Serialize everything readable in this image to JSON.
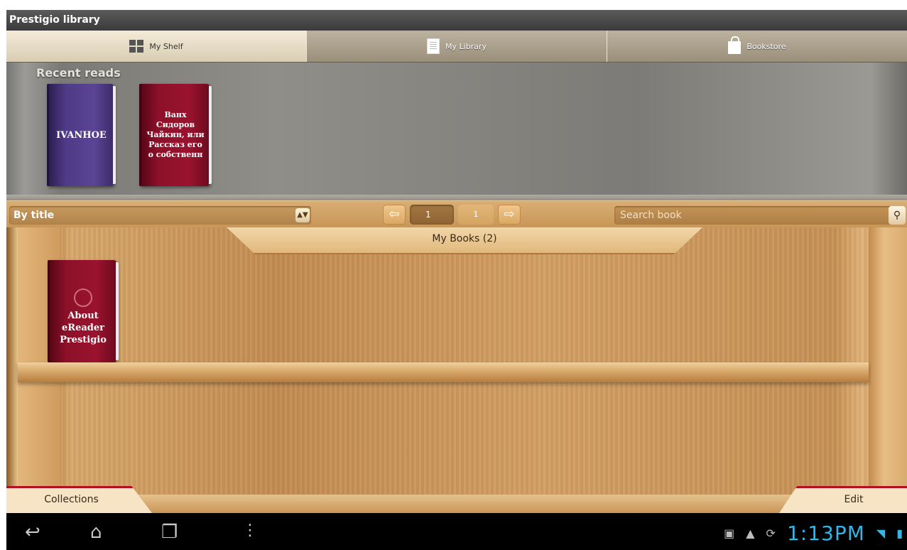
{
  "app": {
    "title": "Prestigio library"
  },
  "tabs": [
    {
      "label": "My Shelf",
      "icon": "grid-icon",
      "active": true
    },
    {
      "label": "My Library",
      "icon": "document-icon",
      "active": false
    },
    {
      "label": "Bookstore",
      "icon": "shopping-bag-icon",
      "active": false
    }
  ],
  "recent": {
    "label": "Recent reads",
    "books": [
      {
        "title": "IVANHOE",
        "color": "#5a4494"
      },
      {
        "title": "Ванх Сидоров Чайкин, или Рассказ его о собственн",
        "color": "#9a132e"
      }
    ]
  },
  "toolbar": {
    "sort_value": "By title",
    "page_current": "1",
    "page_total": "1",
    "search_placeholder": "Search book"
  },
  "shelf": {
    "banner": "My Books (2)",
    "books": [
      {
        "title": "About eReader Prestigio",
        "color": "#9a132e"
      }
    ]
  },
  "bottom": {
    "collections_label": "Collections",
    "edit_label": "Edit"
  },
  "system": {
    "clock": "1:13PM",
    "accent": "#33b5e5"
  }
}
